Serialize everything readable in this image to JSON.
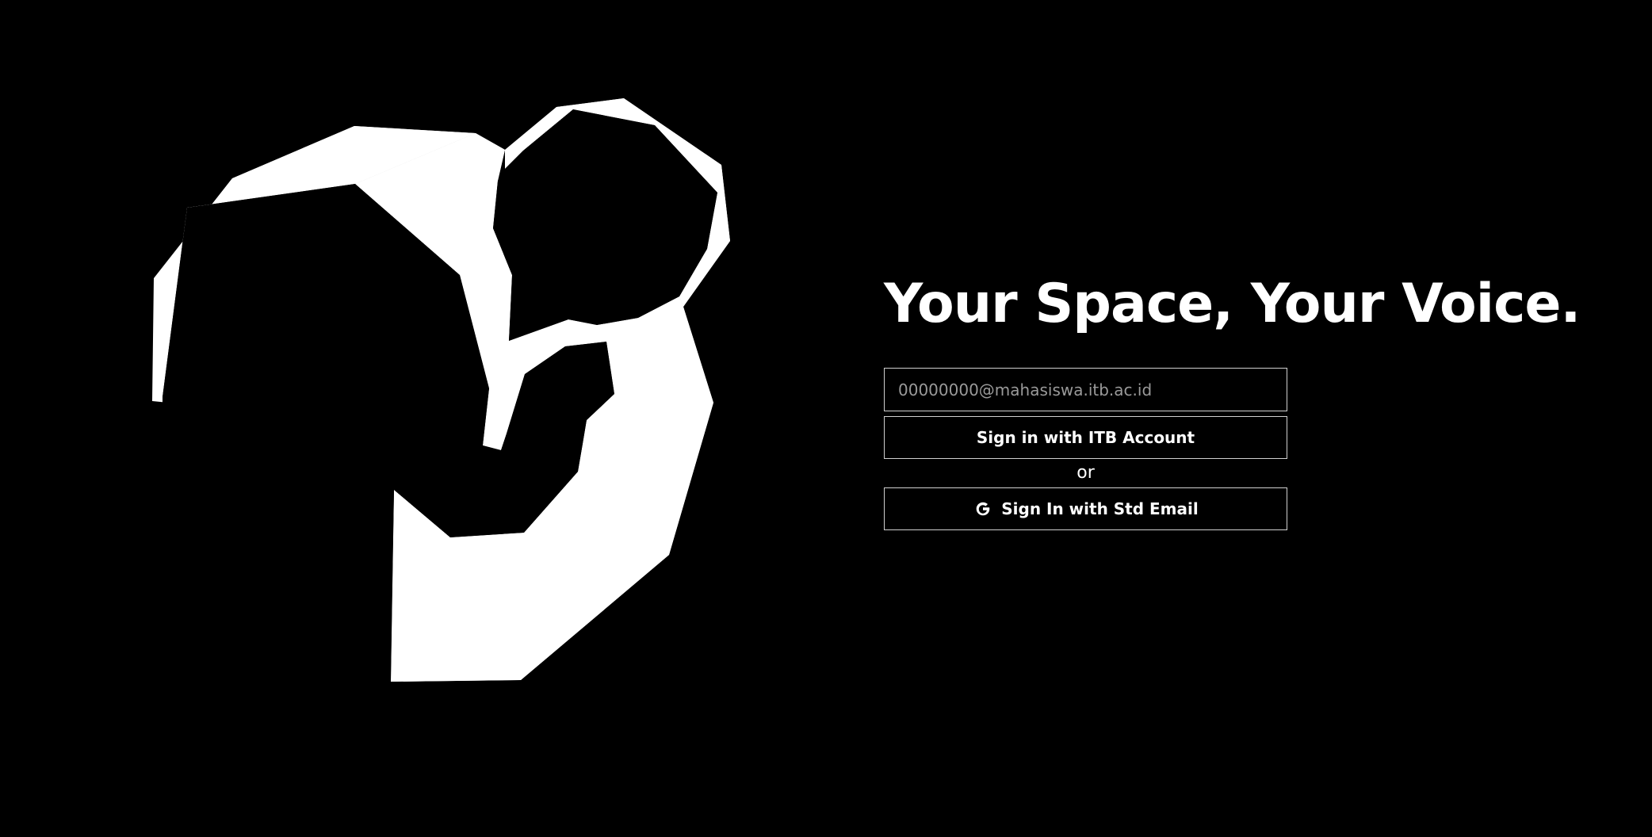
{
  "hero": {
    "headline": "Your Space, Your Voice."
  },
  "login": {
    "email_placeholder": "00000000@mahasiswa.itb.ac.id",
    "email_value": "",
    "itb_button_label": "Sign in with ITB Account",
    "separator": "or",
    "std_email_button_label": "Sign In with Std Email",
    "std_email_button_icon": "google-g-icon"
  },
  "colors": {
    "background": "#000000",
    "foreground": "#ffffff",
    "border": "#d0d0d0",
    "placeholder": "#9a9a9a"
  }
}
